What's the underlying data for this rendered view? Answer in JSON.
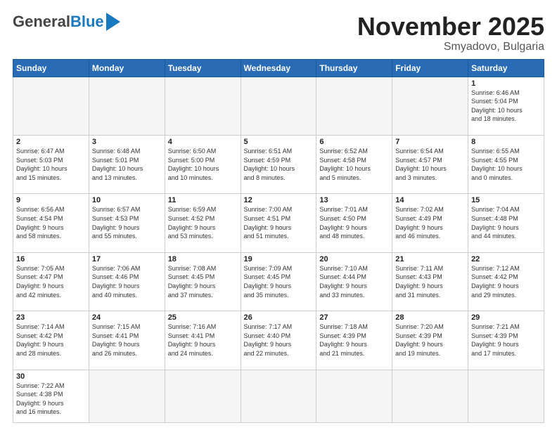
{
  "header": {
    "logo": {
      "general": "General",
      "blue": "Blue"
    },
    "title": "November 2025",
    "subtitle": "Smyadovo, Bulgaria"
  },
  "weekdays": [
    "Sunday",
    "Monday",
    "Tuesday",
    "Wednesday",
    "Thursday",
    "Friday",
    "Saturday"
  ],
  "weeks": [
    [
      {
        "day": "",
        "info": ""
      },
      {
        "day": "",
        "info": ""
      },
      {
        "day": "",
        "info": ""
      },
      {
        "day": "",
        "info": ""
      },
      {
        "day": "",
        "info": ""
      },
      {
        "day": "",
        "info": ""
      },
      {
        "day": "1",
        "info": "Sunrise: 6:46 AM\nSunset: 5:04 PM\nDaylight: 10 hours\nand 18 minutes."
      }
    ],
    [
      {
        "day": "2",
        "info": "Sunrise: 6:47 AM\nSunset: 5:03 PM\nDaylight: 10 hours\nand 15 minutes."
      },
      {
        "day": "3",
        "info": "Sunrise: 6:48 AM\nSunset: 5:01 PM\nDaylight: 10 hours\nand 13 minutes."
      },
      {
        "day": "4",
        "info": "Sunrise: 6:50 AM\nSunset: 5:00 PM\nDaylight: 10 hours\nand 10 minutes."
      },
      {
        "day": "5",
        "info": "Sunrise: 6:51 AM\nSunset: 4:59 PM\nDaylight: 10 hours\nand 8 minutes."
      },
      {
        "day": "6",
        "info": "Sunrise: 6:52 AM\nSunset: 4:58 PM\nDaylight: 10 hours\nand 5 minutes."
      },
      {
        "day": "7",
        "info": "Sunrise: 6:54 AM\nSunset: 4:57 PM\nDaylight: 10 hours\nand 3 minutes."
      },
      {
        "day": "8",
        "info": "Sunrise: 6:55 AM\nSunset: 4:55 PM\nDaylight: 10 hours\nand 0 minutes."
      }
    ],
    [
      {
        "day": "9",
        "info": "Sunrise: 6:56 AM\nSunset: 4:54 PM\nDaylight: 9 hours\nand 58 minutes."
      },
      {
        "day": "10",
        "info": "Sunrise: 6:57 AM\nSunset: 4:53 PM\nDaylight: 9 hours\nand 55 minutes."
      },
      {
        "day": "11",
        "info": "Sunrise: 6:59 AM\nSunset: 4:52 PM\nDaylight: 9 hours\nand 53 minutes."
      },
      {
        "day": "12",
        "info": "Sunrise: 7:00 AM\nSunset: 4:51 PM\nDaylight: 9 hours\nand 51 minutes."
      },
      {
        "day": "13",
        "info": "Sunrise: 7:01 AM\nSunset: 4:50 PM\nDaylight: 9 hours\nand 48 minutes."
      },
      {
        "day": "14",
        "info": "Sunrise: 7:02 AM\nSunset: 4:49 PM\nDaylight: 9 hours\nand 46 minutes."
      },
      {
        "day": "15",
        "info": "Sunrise: 7:04 AM\nSunset: 4:48 PM\nDaylight: 9 hours\nand 44 minutes."
      }
    ],
    [
      {
        "day": "16",
        "info": "Sunrise: 7:05 AM\nSunset: 4:47 PM\nDaylight: 9 hours\nand 42 minutes."
      },
      {
        "day": "17",
        "info": "Sunrise: 7:06 AM\nSunset: 4:46 PM\nDaylight: 9 hours\nand 40 minutes."
      },
      {
        "day": "18",
        "info": "Sunrise: 7:08 AM\nSunset: 4:45 PM\nDaylight: 9 hours\nand 37 minutes."
      },
      {
        "day": "19",
        "info": "Sunrise: 7:09 AM\nSunset: 4:45 PM\nDaylight: 9 hours\nand 35 minutes."
      },
      {
        "day": "20",
        "info": "Sunrise: 7:10 AM\nSunset: 4:44 PM\nDaylight: 9 hours\nand 33 minutes."
      },
      {
        "day": "21",
        "info": "Sunrise: 7:11 AM\nSunset: 4:43 PM\nDaylight: 9 hours\nand 31 minutes."
      },
      {
        "day": "22",
        "info": "Sunrise: 7:12 AM\nSunset: 4:42 PM\nDaylight: 9 hours\nand 29 minutes."
      }
    ],
    [
      {
        "day": "23",
        "info": "Sunrise: 7:14 AM\nSunset: 4:42 PM\nDaylight: 9 hours\nand 28 minutes."
      },
      {
        "day": "24",
        "info": "Sunrise: 7:15 AM\nSunset: 4:41 PM\nDaylight: 9 hours\nand 26 minutes."
      },
      {
        "day": "25",
        "info": "Sunrise: 7:16 AM\nSunset: 4:41 PM\nDaylight: 9 hours\nand 24 minutes."
      },
      {
        "day": "26",
        "info": "Sunrise: 7:17 AM\nSunset: 4:40 PM\nDaylight: 9 hours\nand 22 minutes."
      },
      {
        "day": "27",
        "info": "Sunrise: 7:18 AM\nSunset: 4:39 PM\nDaylight: 9 hours\nand 21 minutes."
      },
      {
        "day": "28",
        "info": "Sunrise: 7:20 AM\nSunset: 4:39 PM\nDaylight: 9 hours\nand 19 minutes."
      },
      {
        "day": "29",
        "info": "Sunrise: 7:21 AM\nSunset: 4:39 PM\nDaylight: 9 hours\nand 17 minutes."
      }
    ],
    [
      {
        "day": "30",
        "info": "Sunrise: 7:22 AM\nSunset: 4:38 PM\nDaylight: 9 hours\nand 16 minutes."
      },
      {
        "day": "",
        "info": ""
      },
      {
        "day": "",
        "info": ""
      },
      {
        "day": "",
        "info": ""
      },
      {
        "day": "",
        "info": ""
      },
      {
        "day": "",
        "info": ""
      },
      {
        "day": "",
        "info": ""
      }
    ]
  ]
}
